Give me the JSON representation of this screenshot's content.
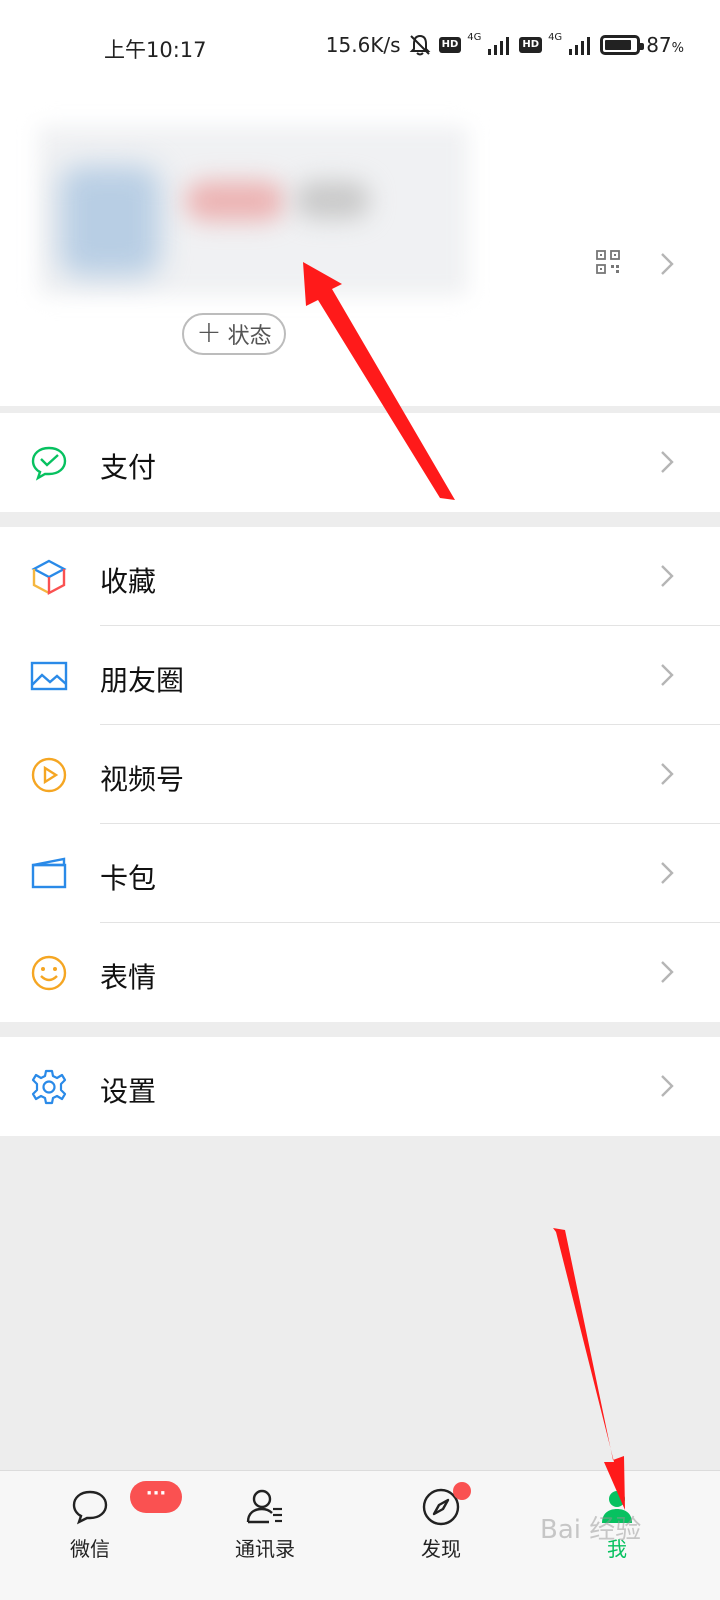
{
  "status_bar": {
    "time": "上午10:17",
    "net_speed": "15.6K/s",
    "hd": "HD",
    "net_type": "4G",
    "battery_pct": "87",
    "battery_unit": "%",
    "battery_level": 0.87
  },
  "profile": {
    "status_button_label": "状态",
    "status_button_plus": "+"
  },
  "menu": {
    "pay": {
      "label": "支付"
    },
    "favorites": {
      "label": "收藏"
    },
    "moments": {
      "label": "朋友圈"
    },
    "channels": {
      "label": "视频号"
    },
    "cards": {
      "label": "卡包"
    },
    "stickers": {
      "label": "表情"
    },
    "settings": {
      "label": "设置"
    }
  },
  "tab_bar": {
    "tabs": [
      {
        "label": "微信",
        "badge": "···"
      },
      {
        "label": "通讯录"
      },
      {
        "label": "发现"
      },
      {
        "label": "我"
      }
    ],
    "watermark": "Bai 经验"
  },
  "colors": {
    "accent_green": "#07c160",
    "badge_red": "#fa5151",
    "annotation_red": "#ff1a1a"
  }
}
